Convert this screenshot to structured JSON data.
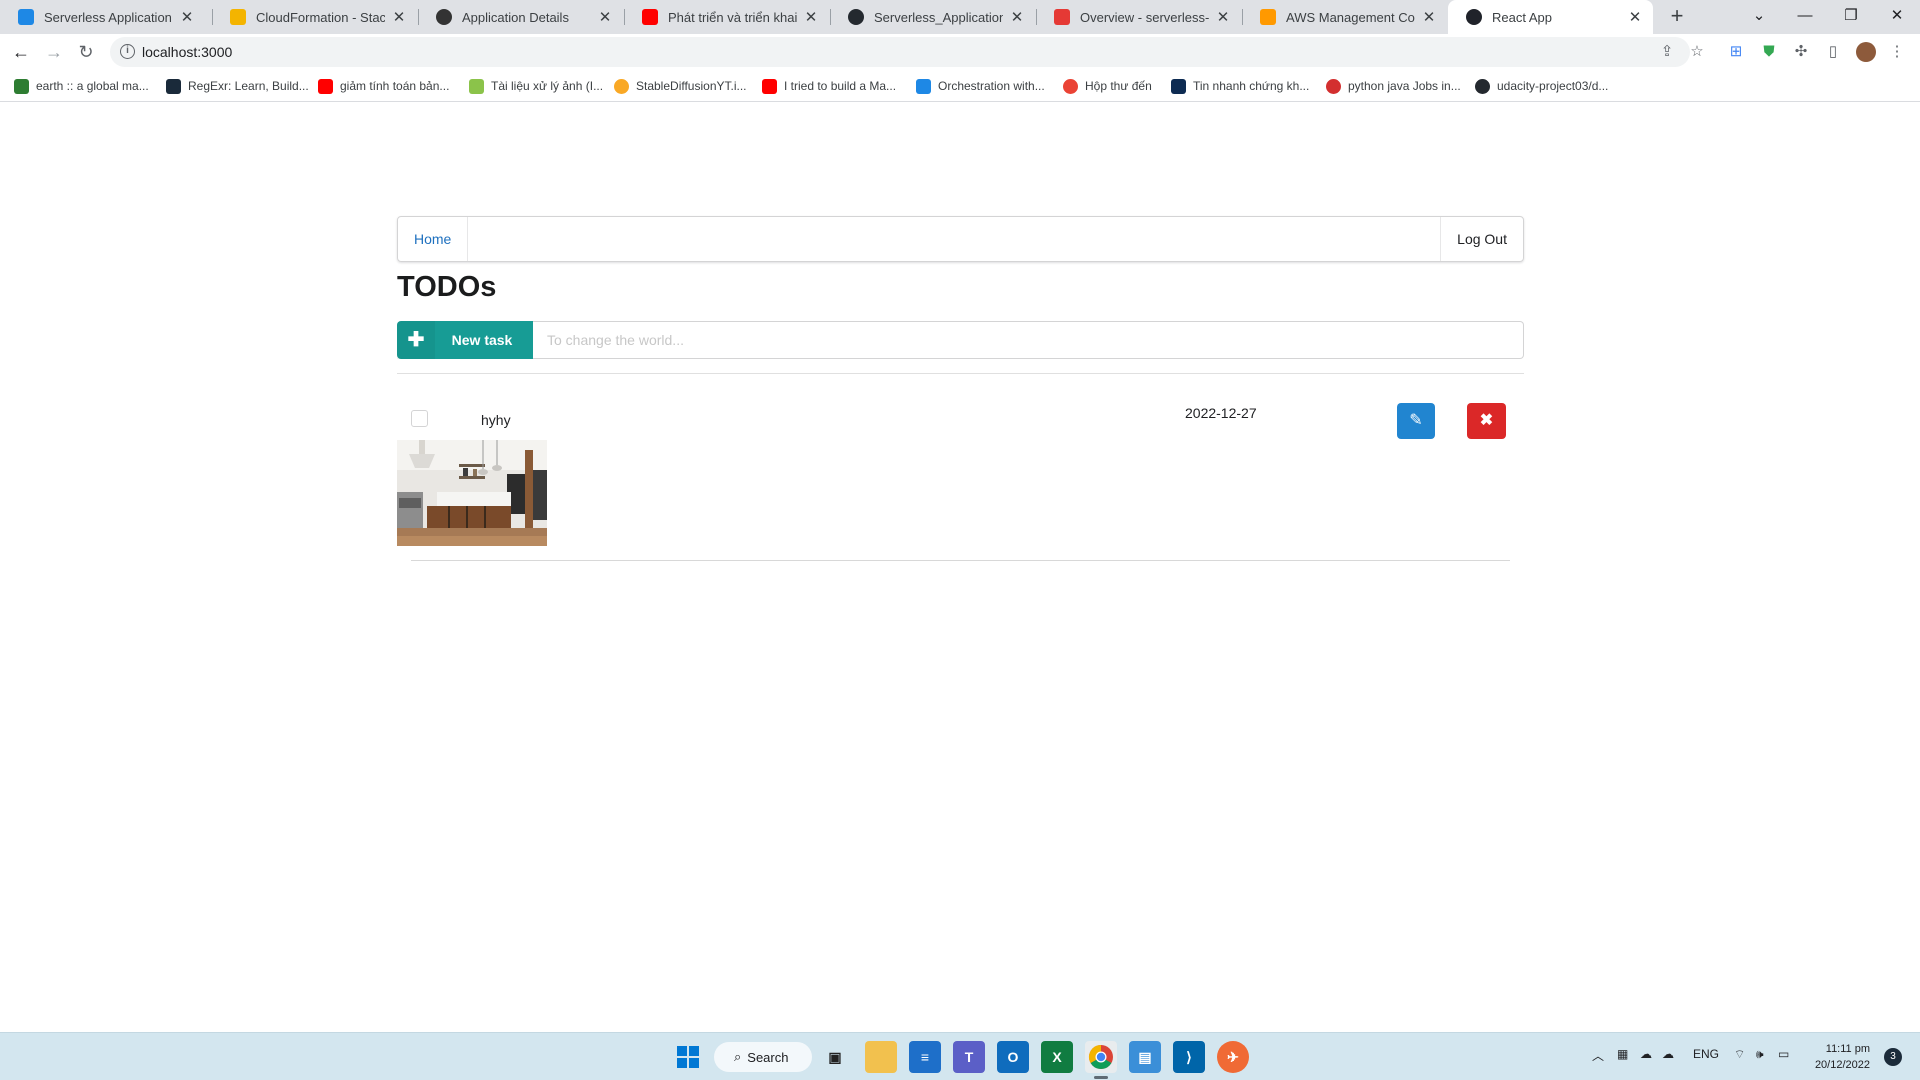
{
  "browser": {
    "tabs": [
      {
        "title": "Serverless Application",
        "color": "#1e88e5"
      },
      {
        "title": "CloudFormation - Stack se",
        "color": "#f4b400"
      },
      {
        "title": "Application Details",
        "color": "#333333"
      },
      {
        "title": "Phát triển và triển khai ứng",
        "color": "#ff0000"
      },
      {
        "title": "Serverless_Application_Pro",
        "color": "#24292f"
      },
      {
        "title": "Overview - serverless-udac",
        "color": "#e53935"
      },
      {
        "title": "AWS Management Console",
        "color": "#ff9900"
      },
      {
        "title": "React App",
        "color": "#20232a"
      }
    ],
    "url": "localhost:3000",
    "bookmarks": [
      {
        "title": "earth :: a global ma...",
        "color": "#2e7d32"
      },
      {
        "title": "RegExr: Learn, Build...",
        "color": "#1a2a3a"
      },
      {
        "title": "giảm tính toán bản...",
        "color": "#ff0000"
      },
      {
        "title": "Tài liệu xử lý ảnh (I...",
        "color": "#8bc34a"
      },
      {
        "title": "StableDiffusionYT.i...",
        "color": "#f9a825"
      },
      {
        "title": "I tried to build a Ma...",
        "color": "#ff0000"
      },
      {
        "title": "Orchestration with...",
        "color": "#1e88e5"
      },
      {
        "title": "Hộp thư đến",
        "color": "#ea4335"
      },
      {
        "title": "Tin nhanh chứng kh...",
        "color": "#0d2b52"
      },
      {
        "title": "python java Jobs in...",
        "color": "#d32f2f"
      },
      {
        "title": "udacity-project03/d...",
        "color": "#24292f"
      }
    ]
  },
  "app": {
    "nav": {
      "home": "Home",
      "logout": "Log Out"
    },
    "title": "TODOs",
    "new_task_label": "New task",
    "new_task_placeholder": "To change the world...",
    "todos": [
      {
        "name": "hyhy",
        "due_date": "2022-12-27",
        "done": false
      }
    ]
  },
  "taskbar": {
    "search_label": "Search",
    "language": "ENG",
    "time": "11:11 pm",
    "date": "20/12/2022",
    "notification_count": "3"
  }
}
